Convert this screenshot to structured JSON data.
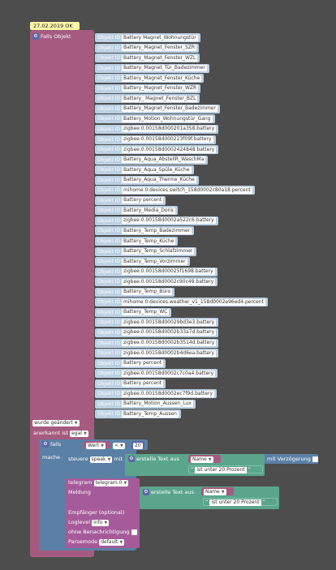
{
  "comment": "27.02.2019 OK",
  "trigger": {
    "title": "Falls Objekt",
    "gear_icon": "gear-icon",
    "objekt_label": "Objekt ID",
    "objects": [
      "Battery Magnet_Wohnungstür",
      "Battery_Magnet_Fenster_SZR",
      "Battery_Magnet_Fenster_WZL",
      "Battery_Magnet_Tür_Badezimmer",
      "Battery_Magnet_Fenster_Küche",
      "Battery_Magnet_Fenster_WZR",
      "Battery_ Magnet_Fenster_BZL",
      "Battery_Magnet_Fenster_Badezimmer",
      "Battery_Motion_Wohnungstür_Gang",
      "zigbee.0.00158d000201a358.battery",
      "zigbee.0.00158d000223f09f.battery",
      "zigbee.0.00158d0002424848.battery",
      "Battery_Aqua_AbstellR_WaschMa",
      "Battery_Aqua_Spüle_Küche",
      "Battery_Aqua_Therme_Küche",
      "mihome.0.devices.switch_158d0002c80a18.percent",
      "Battery percent",
      "Battery_Media_Doris",
      "zigbee.0.00158d0002a522c6.battery",
      "Battery_Temp_Badezimmer",
      "Battery_Temp_Küche",
      "Battery_Temp_Schlafzimmer",
      "Battery_Temp_Vorzimmer",
      "zigbee.0.00158d00025f1698.battery",
      "zigbee.0.00158d0002c90c49.battery",
      "Battery_Temp_Büro",
      "mihome.0.devices.weather_v1_158d0002e96ed4.percent",
      "Battery_Temp_WC",
      "zigbee.0.00158d00029bd3e3.battery",
      "zigbee.0.00158d0002b33a7d.battery",
      "zigbee.0.00158d0002b3514d.battery",
      "zigbee.0.00158d0002b4d6ea.battery",
      "Battery percent",
      "zigbee.0.00158d0002c7c0a4.battery",
      "Battery percent",
      "zigbee.0.00158d0002ec7f9d.battery",
      "Battery_Motion_Aussen_Lux",
      "Battery_Temp_Aussen"
    ],
    "wurde_label": "wurde geändert",
    "anerkannt_label": "anerkannt ist",
    "anerkannt_value": "egal"
  },
  "if_block": {
    "falls_label": "falls",
    "mache_label": "mache",
    "cond_var": "Wert",
    "cond_op": "<",
    "cond_value": "20"
  },
  "speak": {
    "steuere_label": "steuere",
    "speak_value": "speak",
    "mit_label": "mit",
    "erstelle_label": "erstelle Text aus",
    "name_value": "Name",
    "text_value": "ist unter 20 Prozent",
    "verzoegerung_label": "mit Verzögerung"
  },
  "telegram": {
    "title": "telegram",
    "instance": "telegram.0",
    "meldung_label": "Meldung",
    "erstelle_label": "erstelle Text aus",
    "name_value": "Name",
    "text_value": "ist unter 20 Prozent",
    "empfaenger_label": "Empfänger (optional)",
    "loglevel_label": "Loglevel",
    "loglevel_value": "info",
    "ohne_label": "ohne Benachrichtigung",
    "parsemode_label": "Parsemode",
    "parsemode_value": "default"
  },
  "colors": {
    "trigger": "#a55b80",
    "logic": "#5b80a5",
    "text": "#5ba58c",
    "object": "#bcd0e3",
    "comment": "#fbf8a6"
  }
}
